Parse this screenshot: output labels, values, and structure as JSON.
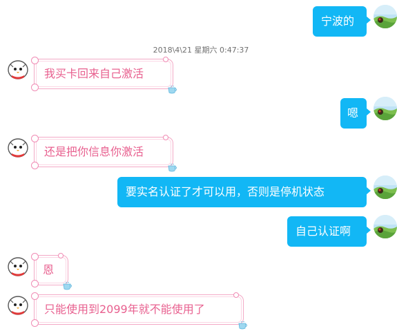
{
  "chat": {
    "timestamp": "2018\\4\\21 星期六 0:47:37",
    "messages": [
      {
        "side": "out",
        "text": "宁波的"
      },
      {
        "side": "in",
        "text": "我买卡回来自己激活"
      },
      {
        "side": "out",
        "text": "嗯"
      },
      {
        "side": "in",
        "text": "还是把你信息你激活"
      },
      {
        "side": "out",
        "text": "要实名认证了才可以用，否则是停机状态"
      },
      {
        "side": "out",
        "text": "自己认证啊"
      },
      {
        "side": "in",
        "text": "恩"
      },
      {
        "side": "in",
        "text": "只能使用到2099年就不能使用了"
      }
    ]
  },
  "colors": {
    "outgoing_bubble": "#12b7f5",
    "incoming_text": "#e8608f",
    "incoming_border": "#f3a9c6",
    "timestamp_text": "#6f6f6f"
  },
  "icons": {
    "self_avatar": "landscape-avatar-icon",
    "other_avatar": "round-bird-avatar-icon",
    "bubble_decoration": "teacup-icon"
  }
}
